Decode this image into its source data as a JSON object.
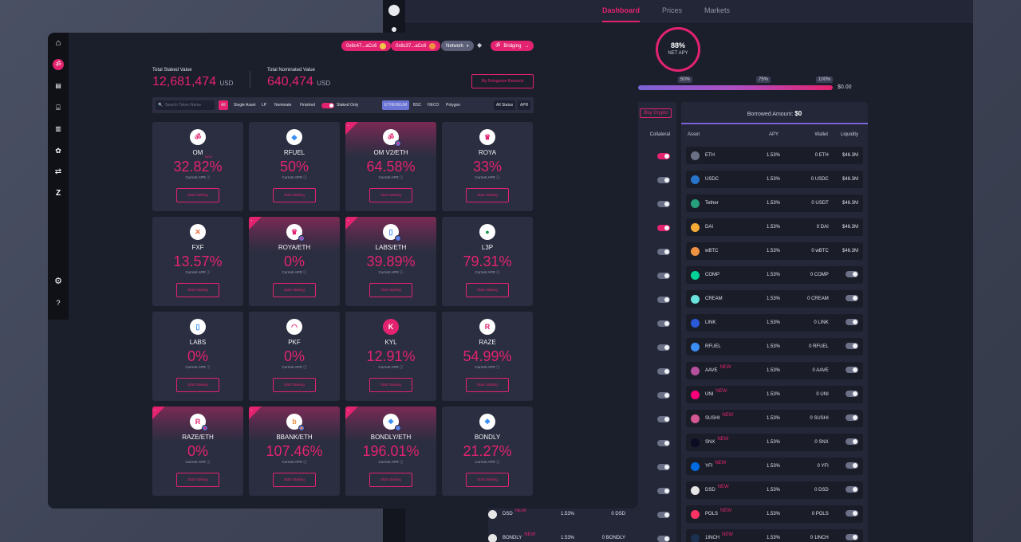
{
  "back": {
    "tabs": [
      {
        "label": "Dashboard",
        "active": true
      },
      {
        "label": "Prices",
        "active": false
      },
      {
        "label": "Markets",
        "active": false
      }
    ],
    "net_apy": {
      "value": "88%",
      "label": "NET APY"
    },
    "progress": {
      "markers": [
        "50%",
        "75%",
        "100%"
      ],
      "amount": "$0.00"
    },
    "buy_crypto": "Buy Crypto",
    "collateral_label": "Collateral",
    "borrowed": {
      "label": "Borrowed Amount:",
      "value": "$0"
    },
    "columns": [
      "Asset",
      "APY",
      "Wallet",
      "Liquidity"
    ],
    "borrow_rows": [
      {
        "name": "ETH",
        "apy": "1.53%",
        "wallet": "0 ETH",
        "liquidity": "$46.3M",
        "new": false,
        "color": "#6c7086"
      },
      {
        "name": "USDC",
        "apy": "1.53%",
        "wallet": "0 USDC",
        "liquidity": "$46.3M",
        "new": false,
        "color": "#2775ca"
      },
      {
        "name": "Tether",
        "apy": "1.53%",
        "wallet": "0 USDT",
        "liquidity": "$46.3M",
        "new": false,
        "color": "#26a17b"
      },
      {
        "name": "DAI",
        "apy": "1.53%",
        "wallet": "0 DAI",
        "liquidity": "$46.3M",
        "new": false,
        "color": "#f5ac37"
      },
      {
        "name": "wBTC",
        "apy": "1.53%",
        "wallet": "0 wBTC",
        "liquidity": "$46.3M",
        "new": false,
        "color": "#f09242"
      },
      {
        "name": "COMP",
        "apy": "1.53%",
        "wallet": "0 COMP",
        "liquidity": "",
        "new": false,
        "color": "#00d395"
      },
      {
        "name": "CREAM",
        "apy": "1.53%",
        "wallet": "0 CREAM",
        "liquidity": "",
        "new": false,
        "color": "#69e2dc"
      },
      {
        "name": "LINK",
        "apy": "1.53%",
        "wallet": "0 LINK",
        "liquidity": "",
        "new": false,
        "color": "#2a5ada"
      },
      {
        "name": "RFUEL",
        "apy": "1.53%",
        "wallet": "0 RFUEL",
        "liquidity": "",
        "new": false,
        "color": "#3a8ef6"
      },
      {
        "name": "AAVE",
        "apy": "1.53%",
        "wallet": "0 AAVE",
        "liquidity": "",
        "new": true,
        "color": "#b6509e"
      },
      {
        "name": "UNI",
        "apy": "1.53%",
        "wallet": "0 UNI",
        "liquidity": "",
        "new": true,
        "color": "#ff007a"
      },
      {
        "name": "SUSHI",
        "apy": "1.53%",
        "wallet": "0 SUSHI",
        "liquidity": "",
        "new": true,
        "color": "#d65892"
      },
      {
        "name": "SNX",
        "apy": "1.53%",
        "wallet": "0 SNX",
        "liquidity": "",
        "new": true,
        "color": "#0b0b22"
      },
      {
        "name": "YFI",
        "apy": "1.53%",
        "wallet": "0 YFI",
        "liquidity": "",
        "new": true,
        "color": "#006ae3"
      },
      {
        "name": "DSD",
        "apy": "1.53%",
        "wallet": "0 DSD",
        "liquidity": "",
        "new": true,
        "color": "#e6e6e6"
      },
      {
        "name": "POLS",
        "apy": "1.53%",
        "wallet": "0 POLS",
        "liquidity": "",
        "new": true,
        "color": "#ff3465"
      },
      {
        "name": "1INCH",
        "apy": "1.53%",
        "wallet": "0 1INCH",
        "liquidity": "",
        "new": true,
        "color": "#1b314f"
      }
    ],
    "left_rows_visible": [
      {
        "name": "DSD",
        "apy": "1.53%",
        "wallet": "0 DSD",
        "new": true
      },
      {
        "name": "BONDLY",
        "apy": "1.53%",
        "wallet": "0 BONDLY",
        "new": true
      }
    ],
    "left_toggles": [
      true,
      false,
      false,
      true,
      false,
      false,
      false,
      false,
      false,
      false,
      false,
      false,
      false,
      false,
      false,
      false,
      false,
      false
    ]
  },
  "front": {
    "pills": [
      {
        "label": "0x8c47...aCc6",
        "style": "pink"
      },
      {
        "label": "0x8c37...aCc6",
        "style": "pink"
      },
      {
        "label": "Network",
        "style": "grey"
      },
      {
        "label": "Bridging",
        "style": "pink"
      }
    ],
    "total_staked": {
      "label": "Total Staked Value",
      "value": "12,681,474",
      "unit": "USD"
    },
    "total_nominated": {
      "label": "Total Nominated Value",
      "value": "640,474",
      "unit": "USD"
    },
    "redeem_button": "My Delegation Rewards",
    "filters": {
      "search_placeholder": "Search Token Name",
      "tabs": [
        "All",
        "Single Asset",
        "LP",
        "Nominate",
        "Finished"
      ],
      "staked_only": "Staked Only",
      "networks": [
        "ETHEREUM",
        "BSC",
        "HECO",
        "Polygon"
      ],
      "status": "All Status",
      "sort": "APR"
    },
    "apr_label": "Current APR",
    "stake_label": "Start Staking",
    "cards": [
      {
        "name": "OM",
        "apr": "32.82%",
        "lp": false,
        "logo_color": "#ffffff",
        "logo_text_color": "#e3236f",
        "logo_glyph": "ॐ",
        "new": true
      },
      {
        "name": "RFUEL",
        "apr": "50%",
        "lp": false,
        "logo_color": "#ffffff",
        "logo_text_color": "#3a8ef6",
        "logo_glyph": "◆",
        "new": false
      },
      {
        "name": "OM V2/ETH",
        "apr": "64.58%",
        "lp": true,
        "logo_color": "#ffffff",
        "logo_text_color": "#e3236f",
        "logo_glyph": "ॐ",
        "new": false
      },
      {
        "name": "ROYA",
        "apr": "33%",
        "lp": false,
        "logo_color": "#ffffff",
        "logo_text_color": "#e3236f",
        "logo_glyph": "♛",
        "new": false
      },
      {
        "name": "FXF",
        "apr": "13.57%",
        "lp": false,
        "logo_color": "#ffffff",
        "logo_text_color": "#f06a3a",
        "logo_glyph": "✕",
        "new": false
      },
      {
        "name": "ROYA/ETH",
        "apr": "0%",
        "lp": true,
        "logo_color": "#ffffff",
        "logo_text_color": "#e3236f",
        "logo_glyph": "♛",
        "new": false
      },
      {
        "name": "LABS/ETH",
        "apr": "39.89%",
        "lp": true,
        "logo_color": "#ffffff",
        "logo_text_color": "#3a8ef6",
        "logo_glyph": "▯",
        "new": false
      },
      {
        "name": "L3P",
        "apr": "79.31%",
        "lp": false,
        "logo_color": "#ffffff",
        "logo_text_color": "#1a9a4a",
        "logo_glyph": "●",
        "new": false
      },
      {
        "name": "LABS",
        "apr": "0%",
        "lp": false,
        "logo_color": "#ffffff",
        "logo_text_color": "#3a8ef6",
        "logo_glyph": "▯",
        "new": false
      },
      {
        "name": "PKF",
        "apr": "0%",
        "lp": false,
        "logo_color": "#ffffff",
        "logo_text_color": "#e3236f",
        "logo_glyph": "◠",
        "new": false
      },
      {
        "name": "KYL",
        "apr": "12.91%",
        "lp": false,
        "logo_color": "#e3236f",
        "logo_text_color": "#ffffff",
        "logo_glyph": "K",
        "new": false
      },
      {
        "name": "RAZE",
        "apr": "54.99%",
        "lp": false,
        "logo_color": "#ffffff",
        "logo_text_color": "#e3236f",
        "logo_glyph": "R",
        "new": false
      },
      {
        "name": "RAZE/ETH",
        "apr": "0%",
        "lp": true,
        "logo_color": "#ffffff",
        "logo_text_color": "#e3236f",
        "logo_glyph": "R",
        "new": false
      },
      {
        "name": "BBANK/ETH",
        "apr": "107.46%",
        "lp": true,
        "logo_color": "#ffffff",
        "logo_text_color": "#f09242",
        "logo_glyph": "b",
        "new": false
      },
      {
        "name": "BONDLY/ETH",
        "apr": "196.01%",
        "lp": true,
        "logo_color": "#ffffff",
        "logo_text_color": "#3a8ef6",
        "logo_glyph": "❖",
        "new": false
      },
      {
        "name": "BONDLY",
        "apr": "21.27%",
        "lp": false,
        "logo_color": "#ffffff",
        "logo_text_color": "#3a8ef6",
        "logo_glyph": "❖",
        "new": false
      }
    ],
    "new_label": "NEW",
    "sidebar_icons": [
      "home-icon",
      "mantra-logo-icon",
      "staking-icon",
      "bank-icon",
      "zen-icon",
      "lotus-icon",
      "swap-icon",
      "zap-icon",
      "gear-icon",
      "help-icon"
    ]
  }
}
